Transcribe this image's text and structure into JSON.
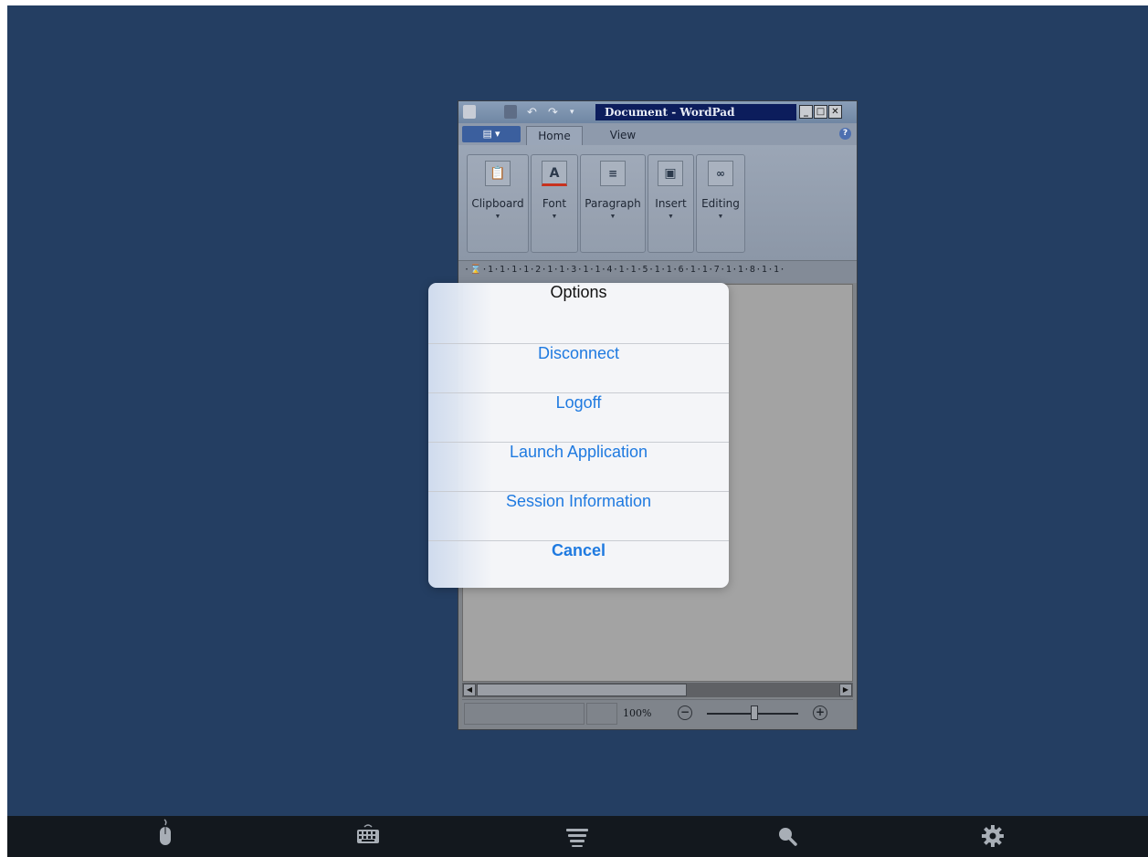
{
  "wordpad": {
    "title": "Document - WordPad",
    "tabs": [
      {
        "label": "Home"
      },
      {
        "label": "View"
      }
    ],
    "ribbon_groups": [
      {
        "label": "Clipboard",
        "icon": "clipboard-icon"
      },
      {
        "label": "Font",
        "icon": "font-color-icon"
      },
      {
        "label": "Paragraph",
        "icon": "paragraph-icon"
      },
      {
        "label": "Insert",
        "icon": "picture-icon"
      },
      {
        "label": "Editing",
        "icon": "binoculars-icon"
      }
    ],
    "ruler_text": "·⌛·1·1·1·1·2·1·1·3·1·1·4·1·1·5·1·1·6·1·1·7·1·1·8·1·1·",
    "zoom_label": "100%",
    "zoom_level": 1.0
  },
  "options_sheet": {
    "title": "Options",
    "items": [
      {
        "label": "Disconnect"
      },
      {
        "label": "Logoff"
      },
      {
        "label": "Launch Application"
      },
      {
        "label": "Session Information"
      }
    ],
    "cancel_label": "Cancel"
  },
  "toolbar": {
    "items": [
      {
        "icon": "mouse-icon"
      },
      {
        "icon": "keyboard-icon"
      },
      {
        "icon": "menu-icon"
      },
      {
        "icon": "search-icon"
      },
      {
        "icon": "gear-icon"
      }
    ]
  },
  "colors": {
    "desktop_background": "#243e62",
    "action_text": "#1f7ae0",
    "toolbar_background": "#13181e"
  }
}
